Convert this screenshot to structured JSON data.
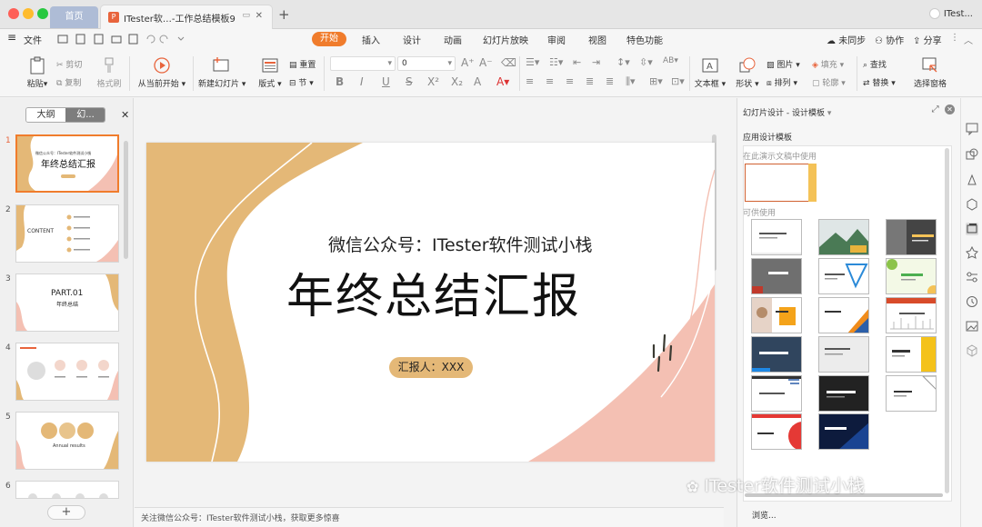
{
  "titlebar": {
    "home_tab": "首页",
    "doc_tab": "ITester软…-工作总结模板9",
    "doc_icon": "P",
    "account": "ITest..."
  },
  "menubar": {
    "file": "文件",
    "tabs": [
      "开始",
      "插入",
      "设计",
      "动画",
      "幻灯片放映",
      "审阅",
      "视图",
      "特色功能"
    ],
    "right": [
      "未同步",
      "协作",
      "分享"
    ]
  },
  "ribbon": {
    "paste": "粘贴",
    "cut": "剪切",
    "copy": "复制",
    "format_painter": "格式刷",
    "play_from_current": "从当前开始",
    "new_slide": "新建幻灯片",
    "layout": "版式",
    "reset": "重置",
    "section": "节",
    "font_size": "0",
    "textbox": "文本框",
    "shape": "形状",
    "picture": "图片",
    "arrange": "排列",
    "fill": "填充",
    "outline": "轮廓",
    "find": "查找",
    "replace": "替换",
    "select_pane": "选择窗格"
  },
  "leftpanel": {
    "outline_tab": "大纲",
    "slides_tab": "幻...",
    "slide_numbers": [
      "1",
      "2",
      "3",
      "4",
      "5",
      "6"
    ],
    "thumb1_sub": "微信公众号：ITester软件测试小栈",
    "thumb1_title": "年终总结汇报",
    "thumb2_title": "CONTENT",
    "thumb3_part": "PART.01",
    "thumb3_title": "年终总结",
    "thumb5_text": "Annual results",
    "add_label": "+"
  },
  "slide": {
    "subtitle": "微信公众号：ITester软件测试小栈",
    "title": "年终总结汇报",
    "reporter": "汇报人：XXX"
  },
  "notes": {
    "text": "关注微信公众号：ITester软件测试小栈，获取更多惊喜"
  },
  "rightpane": {
    "title": "幻灯片设计 - 设计模板",
    "section_label": "应用设计模板",
    "in_use_label": "在此演示文稿中使用",
    "available_label": "可供使用",
    "browse": "浏览...",
    "watermark": "ITester软件测试小栈"
  },
  "colors": {
    "accent": "#f07c2c",
    "slide_gold": "#e4b877",
    "slide_pink": "#f4c0b3"
  }
}
